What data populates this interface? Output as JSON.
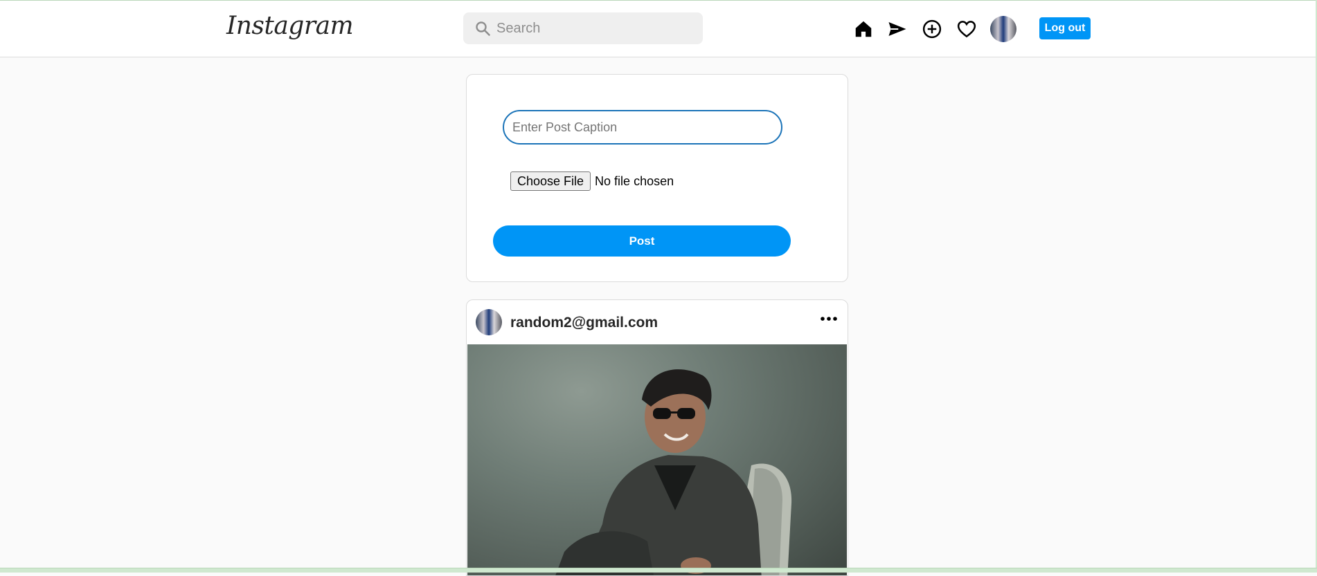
{
  "header": {
    "logo_text": "Instagram",
    "search_placeholder": "Search",
    "search_value": "",
    "nav_icons": [
      "home-icon",
      "send-icon",
      "add-icon",
      "heart-icon",
      "profile-avatar"
    ],
    "logout_label": "Log out"
  },
  "create_post": {
    "caption_placeholder": "Enter Post Caption",
    "caption_value": "",
    "file_button_label": "Choose File",
    "file_status": "No file chosen",
    "post_button_label": "Post"
  },
  "feed": {
    "posts": [
      {
        "username": "random2@gmail.com",
        "more_icon": "ellipsis-icon"
      }
    ]
  },
  "colors": {
    "accent": "#0095f6",
    "input_focus": "#1a73b8",
    "background": "#fafafa",
    "border": "#dbdbdb"
  }
}
